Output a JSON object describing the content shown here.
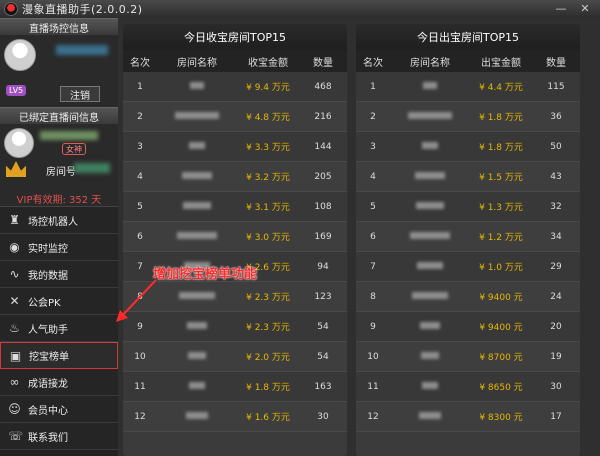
{
  "window": {
    "title": "漫象直播助手(2.0.0.2)"
  },
  "sidebar": {
    "section1_title": "直播场控信息",
    "logout_label": "注销",
    "level_badge": "LV5",
    "section2_title": "已绑定直播间信息",
    "role_badge": "女神",
    "room_label": "房间号",
    "vip_label": "VIP有效期: 352 天",
    "menu": [
      {
        "label": "场控机器人",
        "icon": "robot-icon"
      },
      {
        "label": "实时监控",
        "icon": "camera-icon"
      },
      {
        "label": "我的数据",
        "icon": "chart-icon"
      },
      {
        "label": "公会PK",
        "icon": "swords-icon"
      },
      {
        "label": "人气助手",
        "icon": "fire-icon"
      },
      {
        "label": "挖宝榜单",
        "icon": "treasure-icon"
      },
      {
        "label": "成语接龙",
        "icon": "link-icon"
      },
      {
        "label": "会员中心",
        "icon": "user-gear-icon"
      },
      {
        "label": "联系我们",
        "icon": "contact-icon"
      }
    ]
  },
  "left_panel": {
    "title": "今日收宝房间TOP15",
    "headers": [
      "名次",
      "房间名称",
      "收宝金额",
      "数量"
    ],
    "rows": [
      {
        "rank": "1",
        "amount": "¥ 9.4 万元",
        "count": "468"
      },
      {
        "rank": "2",
        "amount": "¥ 4.8 万元",
        "count": "216"
      },
      {
        "rank": "3",
        "amount": "¥ 3.3 万元",
        "count": "144"
      },
      {
        "rank": "4",
        "amount": "¥ 3.2 万元",
        "count": "205"
      },
      {
        "rank": "5",
        "amount": "¥ 3.1 万元",
        "count": "108"
      },
      {
        "rank": "6",
        "amount": "¥ 3.0 万元",
        "count": "169"
      },
      {
        "rank": "7",
        "amount": "¥ 2.6 万元",
        "count": "94"
      },
      {
        "rank": "8",
        "amount": "¥ 2.3 万元",
        "count": "123"
      },
      {
        "rank": "9",
        "amount": "¥ 2.3 万元",
        "count": "54"
      },
      {
        "rank": "10",
        "amount": "¥ 2.0 万元",
        "count": "54"
      },
      {
        "rank": "11",
        "amount": "¥ 1.8 万元",
        "count": "163"
      },
      {
        "rank": "12",
        "amount": "¥ 1.6 万元",
        "count": "30"
      }
    ]
  },
  "right_panel": {
    "title": "今日出宝房间TOP15",
    "headers": [
      "名次",
      "房间名称",
      "出宝金额",
      "数量"
    ],
    "rows": [
      {
        "rank": "1",
        "amount": "¥ 4.4 万元",
        "count": "115"
      },
      {
        "rank": "2",
        "amount": "¥ 1.8 万元",
        "count": "36"
      },
      {
        "rank": "3",
        "amount": "¥ 1.8 万元",
        "count": "50"
      },
      {
        "rank": "4",
        "amount": "¥ 1.5 万元",
        "count": "43"
      },
      {
        "rank": "5",
        "amount": "¥ 1.3 万元",
        "count": "32"
      },
      {
        "rank": "6",
        "amount": "¥ 1.2 万元",
        "count": "34"
      },
      {
        "rank": "7",
        "amount": "¥ 1.0 万元",
        "count": "29"
      },
      {
        "rank": "8",
        "amount": "¥ 9400 元",
        "count": "24"
      },
      {
        "rank": "9",
        "amount": "¥ 9400 元",
        "count": "20"
      },
      {
        "rank": "10",
        "amount": "¥ 8700 元",
        "count": "19"
      },
      {
        "rank": "11",
        "amount": "¥ 8650 元",
        "count": "30"
      },
      {
        "rank": "12",
        "amount": "¥ 8300 元",
        "count": "17"
      }
    ]
  },
  "annotation": {
    "text": "增加挖宝榜单功能",
    "color": "#ff2a2a"
  },
  "colors": {
    "accent_red": "#d23a3a",
    "amount_gold": "#e8b800",
    "vip_red": "#e05050"
  }
}
